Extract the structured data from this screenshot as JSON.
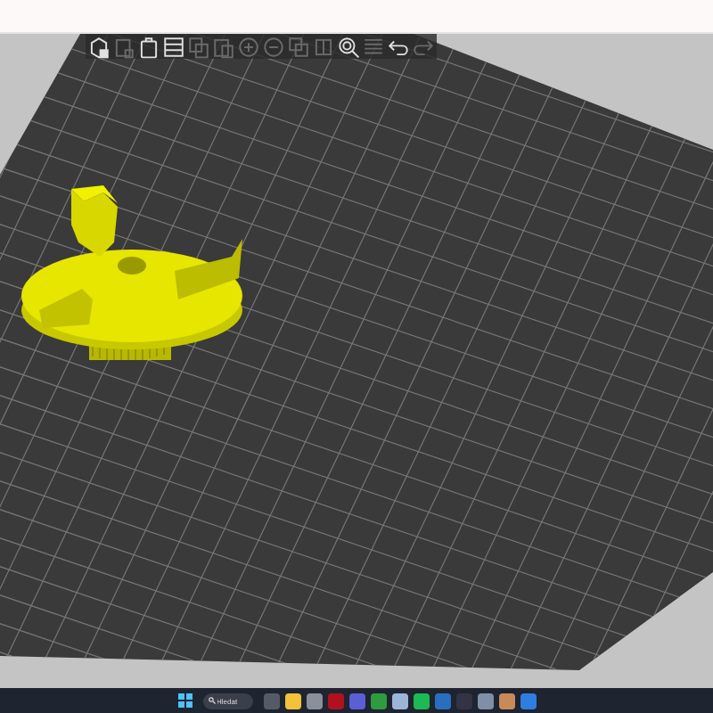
{
  "toolbar": {
    "buttons": [
      {
        "kind": "add",
        "disabled": false
      },
      {
        "kind": "delete",
        "disabled": true
      },
      {
        "kind": "delete-all",
        "disabled": false
      },
      {
        "kind": "arrange",
        "disabled": false
      },
      {
        "kind": "copy",
        "disabled": true
      },
      {
        "kind": "paste",
        "disabled": true
      },
      {
        "kind": "plus",
        "disabled": true
      },
      {
        "kind": "minus",
        "disabled": true
      },
      {
        "kind": "split",
        "disabled": true
      },
      {
        "kind": "split-parts",
        "disabled": true
      },
      {
        "kind": "search",
        "disabled": false
      },
      {
        "kind": "layers",
        "disabled": true
      },
      {
        "kind": "undo",
        "disabled": false
      },
      {
        "kind": "redo",
        "disabled": true
      }
    ]
  },
  "taskbar": {
    "search": {
      "placeholder": "Hledat"
    }
  }
}
